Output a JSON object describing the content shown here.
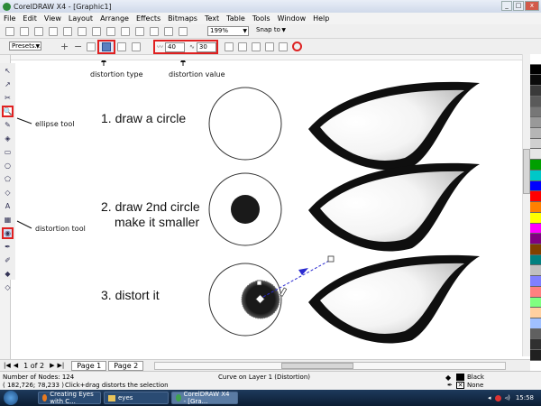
{
  "window": {
    "title": "CorelDRAW X4 - [Graphic1]"
  },
  "menu": [
    "File",
    "Edit",
    "View",
    "Layout",
    "Arrange",
    "Effects",
    "Bitmaps",
    "Text",
    "Table",
    "Tools",
    "Window",
    "Help"
  ],
  "toolbar": {
    "zoom": "199%",
    "snap": "Snap to"
  },
  "property_bar": {
    "presets": "Presets...",
    "distortion_value_a": "40",
    "distortion_value_b": "30"
  },
  "annotations": {
    "distortion_type": "distortion type",
    "distortion_value": "distortion value",
    "ellipse_tool": "ellipse tool",
    "distortion_tool": "distortion tool"
  },
  "steps": [
    {
      "line1": "1. draw a circle",
      "line2": ""
    },
    {
      "line1": "2. draw 2nd circle",
      "line2": "make it smaller"
    },
    {
      "line1": "3. distort it",
      "line2": ""
    }
  ],
  "pages": {
    "indicator": "1 of 2",
    "tabs": [
      "Page 1",
      "Page 2"
    ]
  },
  "status": {
    "nodes": "Number of Nodes: 124",
    "layer": "Curve on Layer 1  (Distortion)",
    "coords": "( 182,726; 78,233 )",
    "hint": "Click+drag distorts the selection",
    "fill": "Black",
    "outline": "None"
  },
  "taskbar": {
    "items": [
      "Creating Eyes with C...",
      "eyes",
      "CorelDRAW X4 - [Gra..."
    ],
    "time": "15:58"
  },
  "palette": [
    "#ffffff",
    "#000000",
    "#0a0a0a",
    "#3a3a3a",
    "#5a5a5a",
    "#777777",
    "#999999",
    "#b5b5b5",
    "#d0d0d0",
    "#e6e6e6",
    "#00a000",
    "#00c8c8",
    "#0000ff",
    "#ff0000",
    "#ff8000",
    "#ffff00",
    "#ff00ff",
    "#800080",
    "#804000",
    "#008080",
    "#c0c0c0",
    "#8080ff",
    "#ff8080",
    "#80ff80",
    "#ffd0a0",
    "#a0c0ff",
    "#606060",
    "#303030",
    "#202020"
  ]
}
